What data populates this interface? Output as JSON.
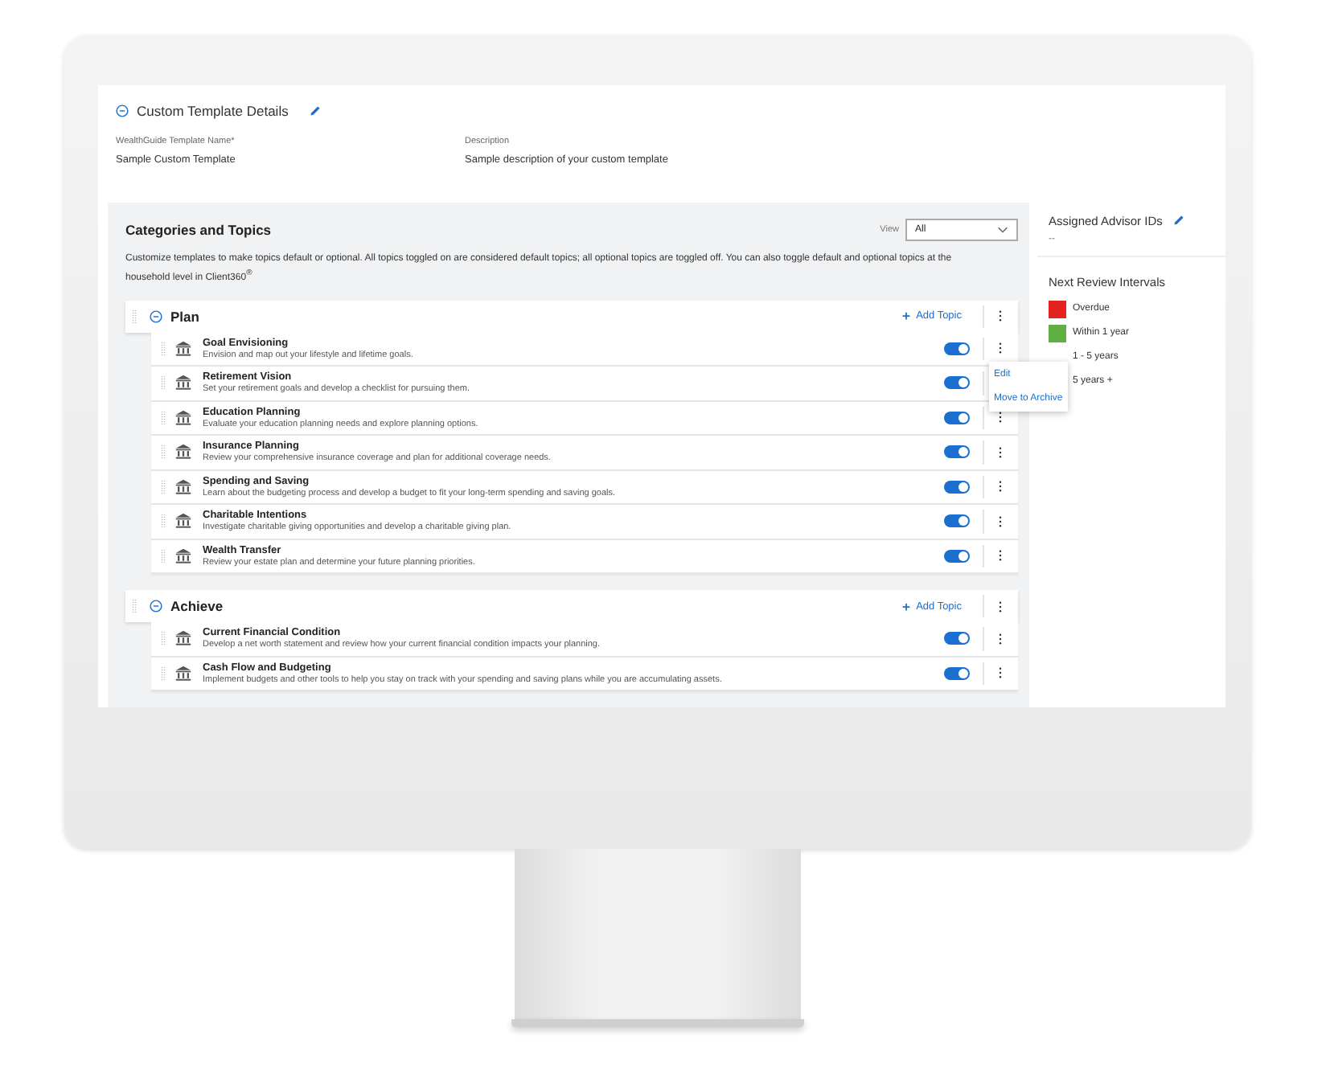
{
  "details": {
    "title": "Custom Template Details",
    "expanded": true,
    "fields": [
      {
        "label": "WealthGuide Template Name*",
        "value": "Sample Custom Template"
      },
      {
        "label": "Description",
        "value": "Sample description of your custom template"
      }
    ]
  },
  "categories_panel": {
    "title": "Categories and Topics",
    "view_label": "View",
    "view_value": "All",
    "intro": "Customize templates to make topics default or optional. All topics toggled on are considered default topics; all optional topics are toggled off. You can also toggle default and optional topics at the household level in Client360$^{®}$",
    "categories": [
      {
        "name": "Plan",
        "expanded": true,
        "add_label": "Add Topic",
        "topics": [
          {
            "title": "Goal Envisioning",
            "description": "Envision and map out your lifestyle and lifetime goals.",
            "on": true
          },
          {
            "title": "Retirement Vision",
            "description": "Set your retirement goals and develop a checklist for pursuing them.",
            "on": true
          },
          {
            "title": "Education Planning",
            "description": "Evaluate your education planning needs and explore planning options.",
            "on": true
          },
          {
            "title": "Insurance Planning",
            "description": "Review your comprehensive insurance coverage and plan for additional coverage needs.",
            "on": true
          },
          {
            "title": "Spending and Saving",
            "description": "Learn about the budgeting process and develop a budget to fit your long-term spending and saving goals.",
            "on": true
          },
          {
            "title": "Charitable Intentions",
            "description": "Investigate charitable giving opportunities and develop a charitable giving plan.",
            "on": true
          },
          {
            "title": "Wealth Transfer",
            "description": "Review your estate plan and determine your future planning priorities.",
            "on": true
          }
        ]
      },
      {
        "name": "Achieve",
        "expanded": true,
        "add_label": "Add Topic",
        "topics": [
          {
            "title": "Current Financial Condition",
            "description": "Develop a net worth statement and review how your current financial condition impacts your planning.",
            "on": true
          },
          {
            "title": "Cash Flow and Budgeting",
            "description": "Implement budgets and other tools to help you stay on track with your spending and saving plans while you are accumulating assets.",
            "on": true
          }
        ]
      }
    ]
  },
  "context_menu": {
    "open": true,
    "items": [
      "Edit",
      "Move to Archive"
    ]
  },
  "sidebar": {
    "advisor_title": "Assigned Advisor IDs",
    "advisor_value": "--",
    "intervals_title": "Next Review Intervals",
    "intervals": [
      {
        "label": "Overdue",
        "color": "#e52222"
      },
      {
        "label": "Within 1 year",
        "color": "#5fb042"
      },
      {
        "label": "1 - 5 years"
      },
      {
        "label": "5 years +"
      }
    ]
  }
}
